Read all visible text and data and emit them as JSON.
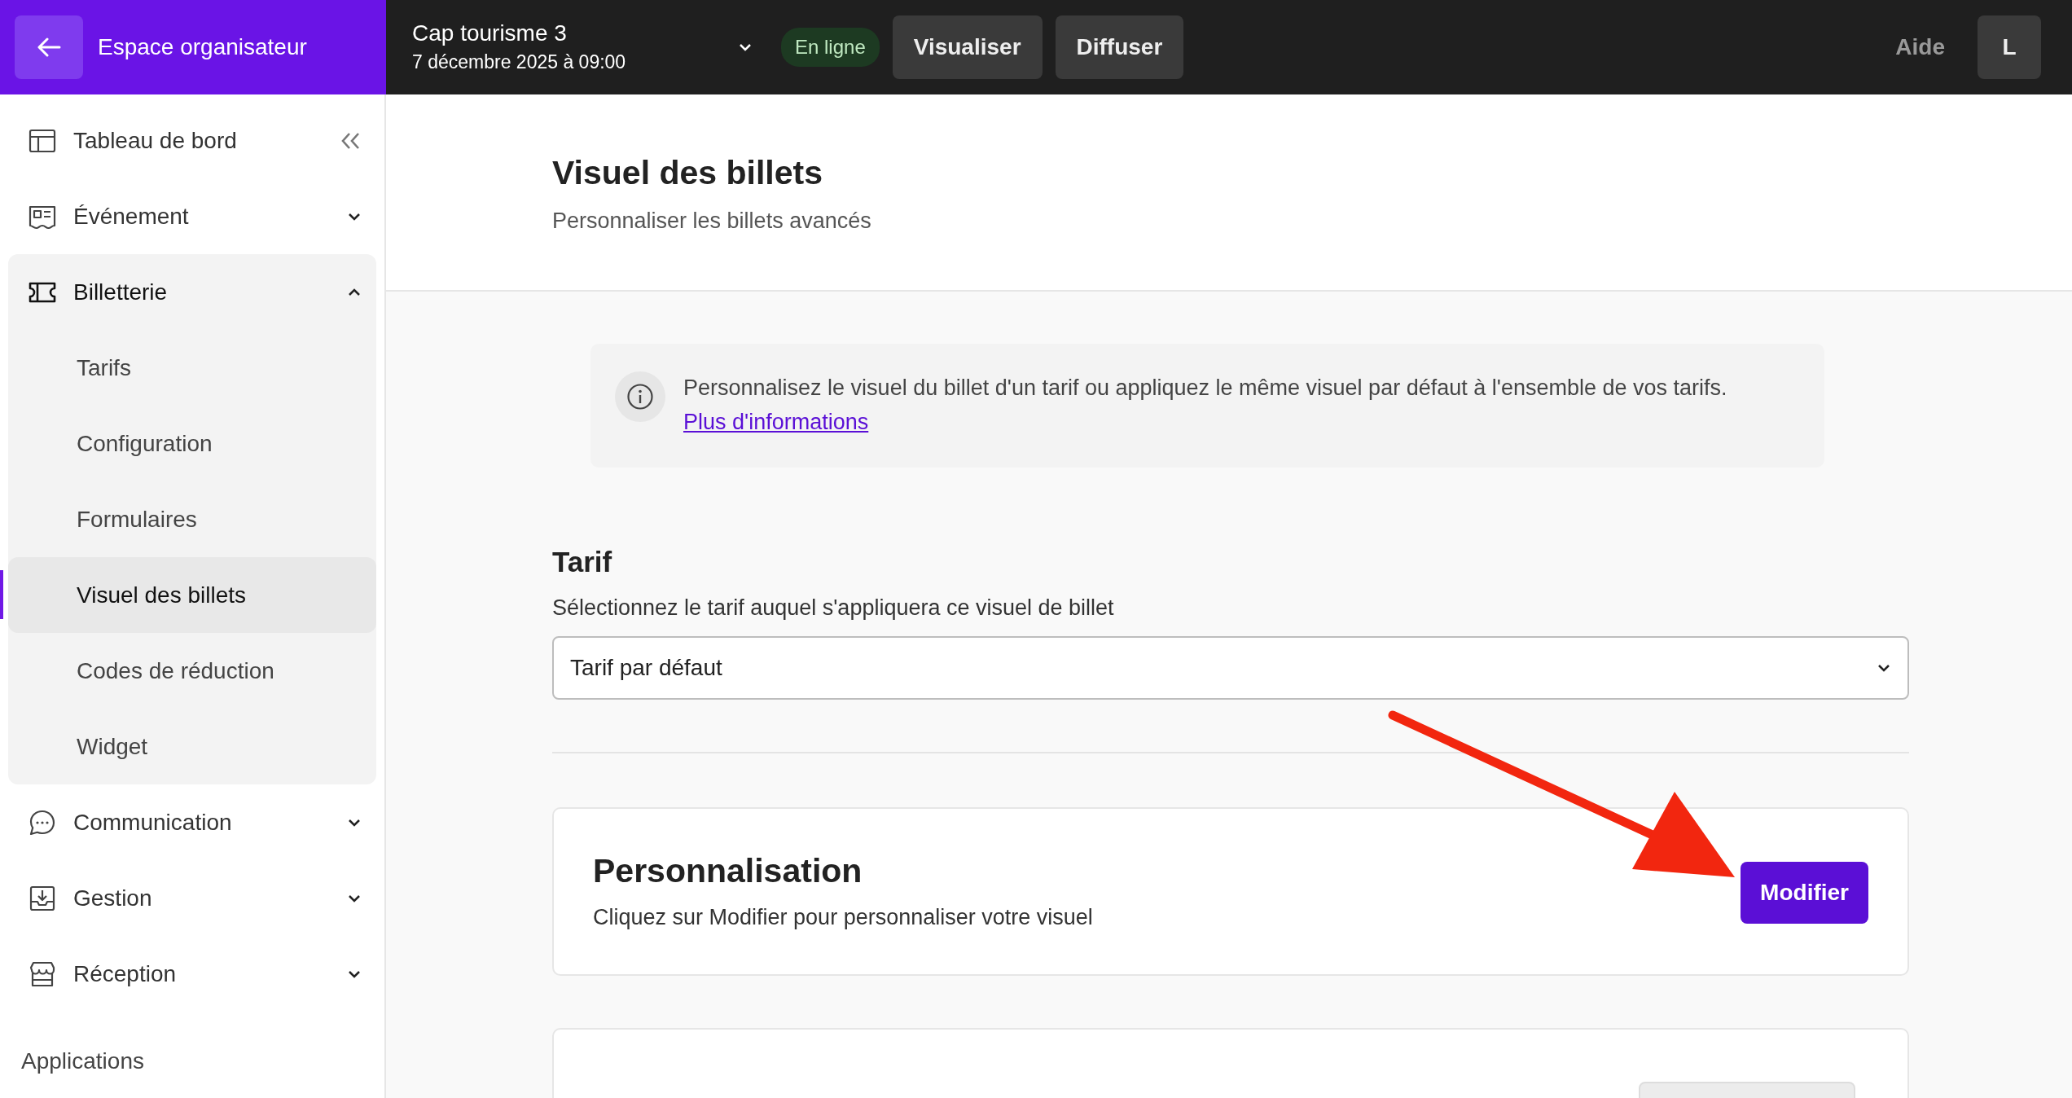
{
  "topbar": {
    "back_label": "Espace organisateur",
    "event": {
      "title": "Cap tourisme 3",
      "date": "7 décembre 2025 à 09:00"
    },
    "status": "En ligne",
    "buttons": [
      "Visualiser",
      "Diffuser"
    ],
    "help": "Aide",
    "avatar": "L"
  },
  "sidebar": {
    "items": [
      {
        "label": "Tableau de bord",
        "kind": "collapse"
      },
      {
        "label": "Événement",
        "kind": "group",
        "expanded": false
      },
      {
        "label": "Billetterie",
        "kind": "group",
        "expanded": true,
        "children": [
          {
            "label": "Tarifs",
            "selected": false
          },
          {
            "label": "Configuration",
            "selected": false
          },
          {
            "label": "Formulaires",
            "selected": false
          },
          {
            "label": "Visuel des billets",
            "selected": true
          },
          {
            "label": "Codes de réduction",
            "selected": false
          },
          {
            "label": "Widget",
            "selected": false
          }
        ]
      },
      {
        "label": "Communication",
        "kind": "group",
        "expanded": false
      },
      {
        "label": "Gestion",
        "kind": "group",
        "expanded": false
      },
      {
        "label": "Réception",
        "kind": "group",
        "expanded": false
      }
    ],
    "section": "Applications"
  },
  "page": {
    "title": "Visuel des billets",
    "subtitle": "Personnaliser les billets avancés"
  },
  "notice": {
    "text": "Personnalisez le visuel du billet d'un tarif ou appliquez le même visuel par défaut à l'ensemble de vos tarifs.",
    "link": "Plus d'informations"
  },
  "tarif": {
    "title": "Tarif",
    "hint": "Sélectionnez le tarif auquel s'appliquera ce visuel de billet",
    "value": "Tarif par défaut"
  },
  "customization": {
    "title": "Personnalisation",
    "text": "Cliquez sur Modifier pour personnaliser votre visuel",
    "button": "Modifier"
  }
}
